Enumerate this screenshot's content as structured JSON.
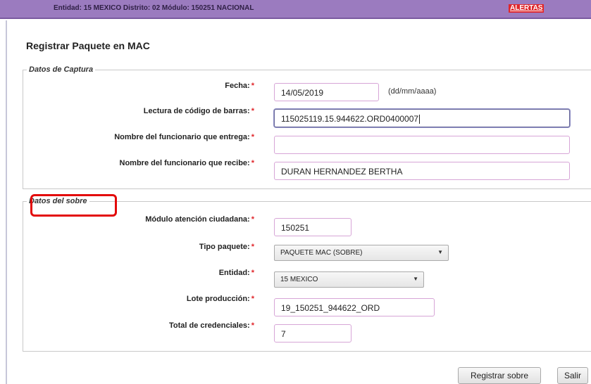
{
  "topbar": {
    "info": "Entidad: 15 MEXICO Distrito: 02 Módulo: 150251 NACIONAL",
    "alerts_label": "ALERTAS"
  },
  "page": {
    "title": "Registrar Paquete en MAC"
  },
  "captura": {
    "legend": "Datos de Captura",
    "fecha": {
      "label": "Fecha:",
      "value": "14/05/2019",
      "hint": "(dd/mm/aaaa)"
    },
    "codigo": {
      "label": "Lectura de código de barras:",
      "value": "115025119.15.944622.ORD0400007"
    },
    "entrega": {
      "label": "Nombre del funcionario que entrega:",
      "value": ""
    },
    "recibe": {
      "label": "Nombre del funcionario que recibe:",
      "value": "DURAN HERNANDEZ BERTHA"
    }
  },
  "sobre": {
    "legend": "Datos del sobre",
    "modulo": {
      "label": "Módulo atención ciudadana:",
      "value": "150251"
    },
    "tipo": {
      "label": "Tipo paquete:",
      "value": "PAQUETE MAC (SOBRE)"
    },
    "entidad": {
      "label": "Entidad:",
      "value": "15 MEXICO"
    },
    "lote": {
      "label": "Lote producción:",
      "value": "19_150251_944622_ORD"
    },
    "total": {
      "label": "Total de credenciales:",
      "value": "7"
    }
  },
  "required_mark": "*",
  "actions": {
    "register": "Registrar sobre",
    "exit": "Salir"
  },
  "colors": {
    "topbar": "#9b7bbf",
    "alert": "#e0262b",
    "highlight": "#e30a0a",
    "field_border": "#d7a5d7"
  }
}
